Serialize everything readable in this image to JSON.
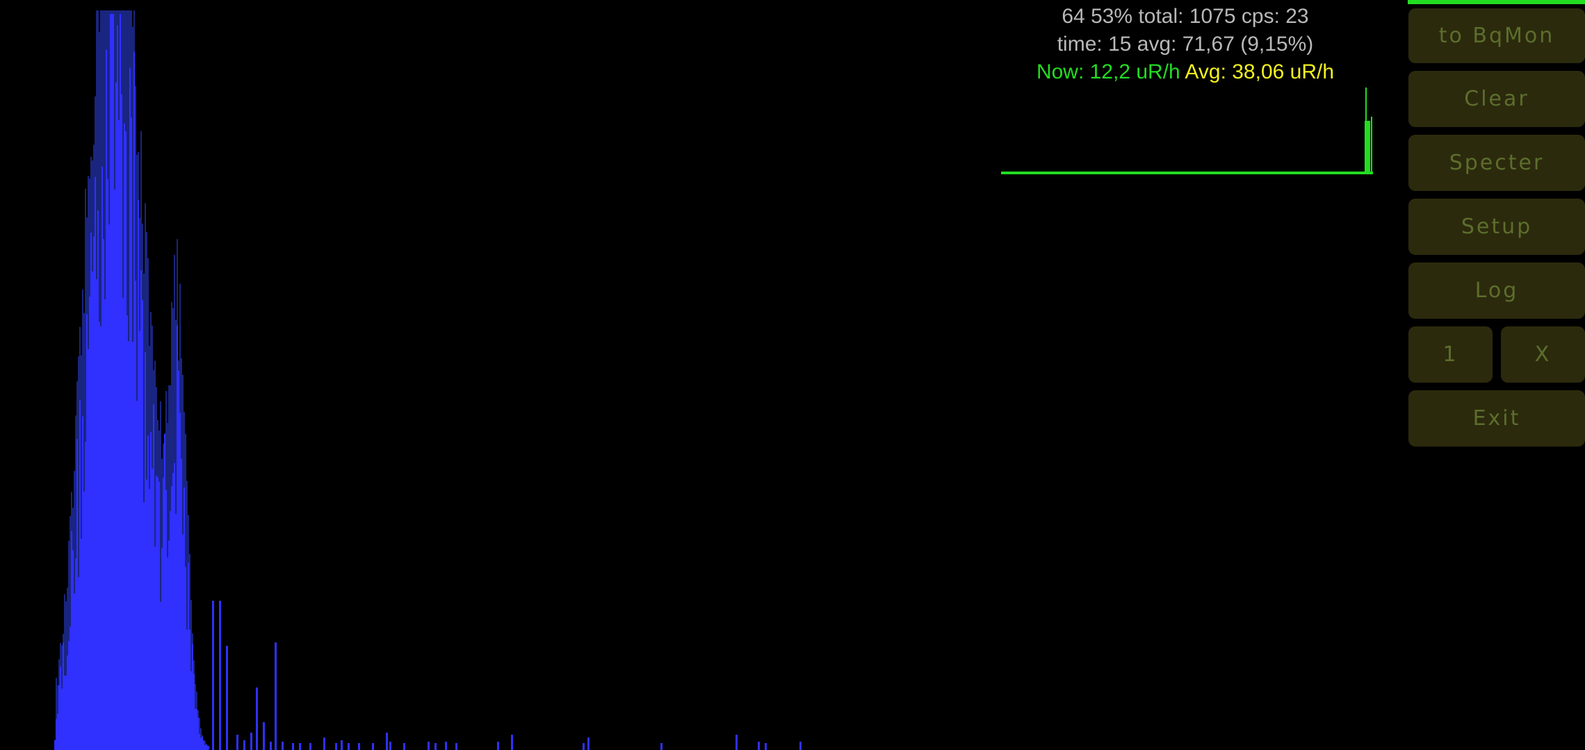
{
  "stats": {
    "line1": "64 53% total: 1075 cps: 23",
    "line2": "time: 15 avg: 71,67 (9,15%)",
    "now": "Now: 12,2 uR/h",
    "avg": "Avg: 38,06 uR/h"
  },
  "colors": {
    "spectrum_fill": "#3030ff",
    "spectrum_shadow": "#1a2580",
    "history_line": "#22dd22",
    "now_text": "#22dd22",
    "avg_text": "#f0f020",
    "button_bg": "#2c2a0d",
    "button_text": "#5c6e2c"
  },
  "buttons": {
    "to_bqmon": "to BqMon",
    "clear": "Clear",
    "specter": "Specter",
    "setup": "Setup",
    "log": "Log",
    "one": "1",
    "x": "X",
    "exit": "Exit"
  }
}
